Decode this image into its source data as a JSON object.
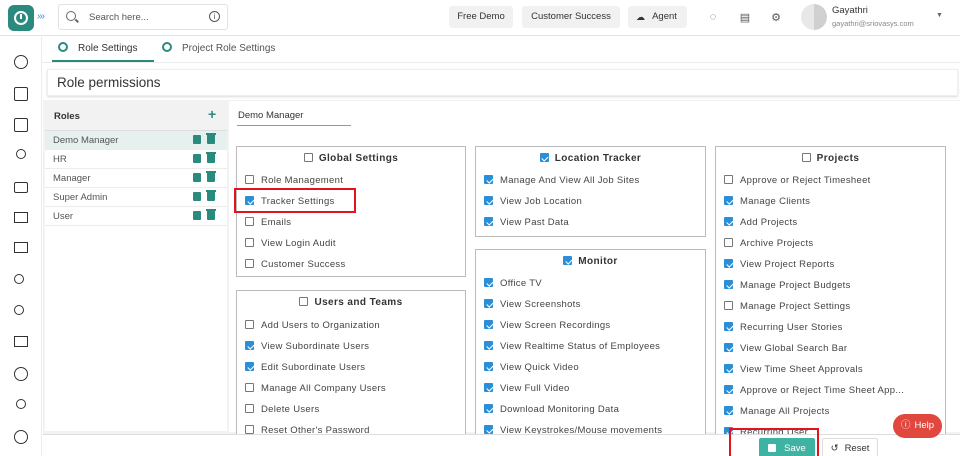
{
  "search": {
    "placeholder": "Search here..."
  },
  "header": {
    "buttons": [
      "Free Demo",
      "Customer Success",
      "Agent"
    ],
    "user_name": "Gayathri",
    "user_email": "gayathri@sriovasys.com"
  },
  "tabs": [
    "Role Settings",
    "Project Role Settings"
  ],
  "page_title": "Role permissions",
  "roles": {
    "heading": "Roles",
    "items": [
      "Demo Manager",
      "HR",
      "Manager",
      "Super Admin",
      "User"
    ],
    "selected": "Demo Manager"
  },
  "role_name_value": "Demo Manager",
  "sections": {
    "global": {
      "title": "Global Settings",
      "checked": false,
      "items": [
        {
          "label": "Role Management",
          "checked": false
        },
        {
          "label": "Tracker Settings",
          "checked": true
        },
        {
          "label": "Emails",
          "checked": false
        },
        {
          "label": "View Login Audit",
          "checked": false
        },
        {
          "label": "Customer Success",
          "checked": false
        }
      ]
    },
    "users": {
      "title": "Users and Teams",
      "checked": false,
      "items": [
        {
          "label": "Add Users to Organization",
          "checked": false
        },
        {
          "label": "View Subordinate Users",
          "checked": true
        },
        {
          "label": "Edit Subordinate Users",
          "checked": true
        },
        {
          "label": "Manage All Company Users",
          "checked": false
        },
        {
          "label": "Delete Users",
          "checked": false
        },
        {
          "label": "Reset Other's Password",
          "checked": false
        }
      ]
    },
    "location": {
      "title": "Location Tracker",
      "checked": true,
      "items": [
        {
          "label": "Manage And View All Job Sites",
          "checked": true
        },
        {
          "label": "View Job Location",
          "checked": true
        },
        {
          "label": "View Past Data",
          "checked": true
        }
      ]
    },
    "monitor": {
      "title": "Monitor",
      "checked": true,
      "items": [
        {
          "label": "Office TV",
          "checked": true
        },
        {
          "label": "View Screenshots",
          "checked": true
        },
        {
          "label": "View Screen Recordings",
          "checked": true
        },
        {
          "label": "View Realtime Status of Employees",
          "checked": true
        },
        {
          "label": "View Quick Video",
          "checked": true
        },
        {
          "label": "View Full Video",
          "checked": true
        },
        {
          "label": "Download Monitoring Data",
          "checked": true
        },
        {
          "label": "View Keystrokes/Mouse movements",
          "checked": true
        }
      ]
    },
    "projects": {
      "title": "Projects",
      "checked": false,
      "items": [
        {
          "label": "Approve or Reject Timesheet",
          "checked": false
        },
        {
          "label": "Manage Clients",
          "checked": true
        },
        {
          "label": "Add Projects",
          "checked": true
        },
        {
          "label": "Archive Projects",
          "checked": false
        },
        {
          "label": "View Project Reports",
          "checked": true
        },
        {
          "label": "Manage Project Budgets",
          "checked": true
        },
        {
          "label": "Manage Project Settings",
          "checked": false
        },
        {
          "label": "Recurring User Stories",
          "checked": true
        },
        {
          "label": "View Global Search Bar",
          "checked": true
        },
        {
          "label": "View Time Sheet Approvals",
          "checked": true
        },
        {
          "label": "Approve or Reject Time Sheet App...",
          "checked": true
        },
        {
          "label": "Manage All Projects",
          "checked": true
        },
        {
          "label": "Recurring User",
          "checked": true
        }
      ]
    }
  },
  "actions": {
    "save": "Save",
    "reset": "Reset",
    "help": "Help"
  }
}
